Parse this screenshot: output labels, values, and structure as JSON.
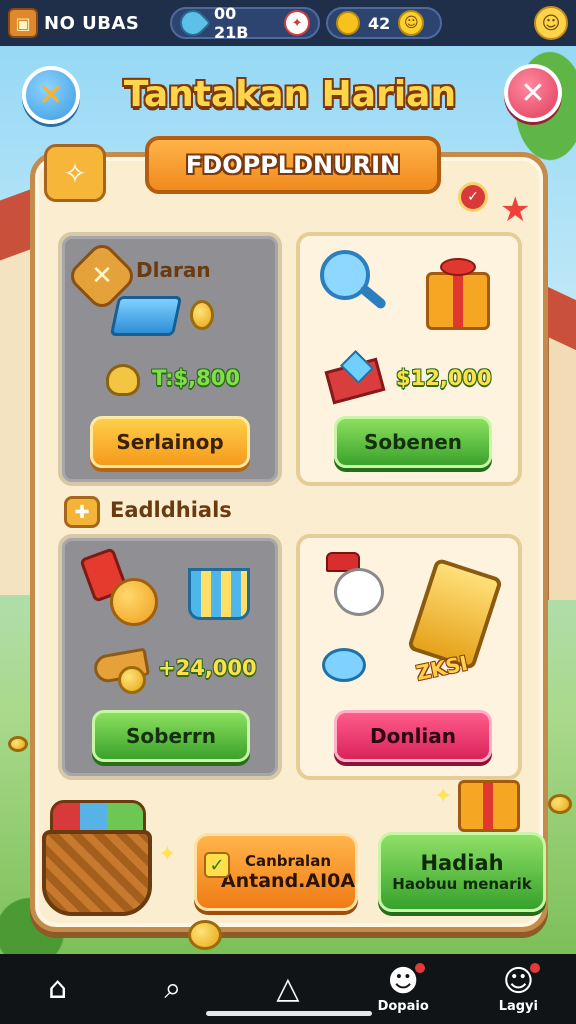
{
  "topbar": {
    "title": "NO UBAS",
    "timer": "00 21B",
    "coins": "42",
    "chest_icon": "chest-icon",
    "rocket_icon": "rocket-icon",
    "badge_icon": "badge-icon",
    "coin_icon": "coin-icon",
    "avatar_icon": "avatar-icon"
  },
  "header": {
    "title": "Tantakan Harian",
    "left_icon": "tools-icon",
    "close_icon": "close-icon"
  },
  "panel": {
    "banner": "FDOPPLDNURIN",
    "section_label": "Eadldhials",
    "cards": [
      {
        "label": "Dlaran",
        "price": "T:$,800",
        "button": "Serlainop",
        "button_color": "#f59a1b"
      },
      {
        "label": "",
        "price": "$12,000",
        "button": "Sobenen",
        "button_color": "#3ba22c"
      },
      {
        "label": "",
        "price": "+24,000",
        "button": "Soberrn",
        "button_color": "#3ba22c"
      },
      {
        "label": "",
        "tag": "ZKSI",
        "price": "",
        "button": "Donlian",
        "button_color": "#d9235a"
      }
    ]
  },
  "actions": {
    "left": {
      "line1": "Canbralan",
      "line2": "Antand.AI0A"
    },
    "right": {
      "line1": "Hadiah",
      "line2": "Haobuu menarik"
    }
  },
  "bottom_nav": {
    "items": [
      {
        "icon": "home-icon",
        "label": ""
      },
      {
        "icon": "search-icon",
        "label": ""
      },
      {
        "icon": "house-outline-icon",
        "label": ""
      },
      {
        "icon": "pet-icon",
        "label": "Dopaio"
      },
      {
        "icon": "character-icon",
        "label": "Lagyi"
      }
    ]
  },
  "colors": {
    "accent": "#f59a1b",
    "panel": "#fbeed0",
    "title": "#ffd64a",
    "topbar": "#1f2f4a"
  }
}
